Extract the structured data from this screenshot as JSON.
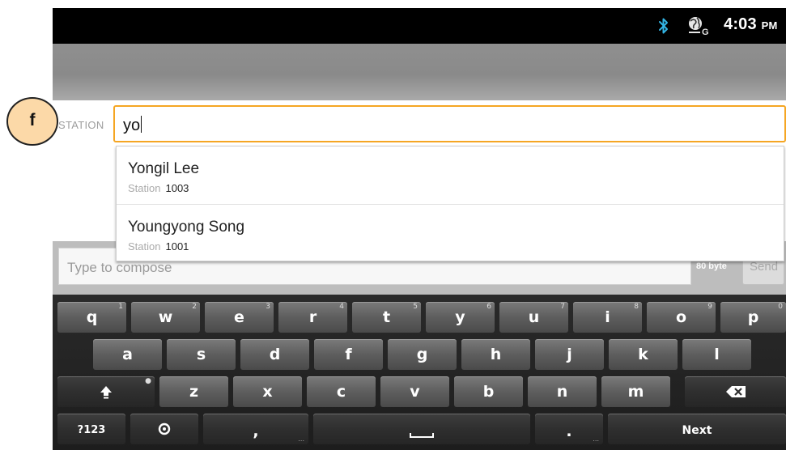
{
  "status_bar": {
    "time": "4:03",
    "ampm": "PM",
    "icons": [
      "bluetooth-icon",
      "network-data-icon"
    ]
  },
  "annotation": {
    "marker": "f"
  },
  "station_field": {
    "label": "STATION",
    "value": "yo"
  },
  "suggestions": [
    {
      "name": "Yongil Lee",
      "sub_label": "Station",
      "number": "1003"
    },
    {
      "name": "Youngyong Song",
      "sub_label": "Station",
      "number": "1001"
    }
  ],
  "compose": {
    "placeholder": "Type to compose",
    "byte_count": "80 byte",
    "send_label": "Send"
  },
  "keyboard": {
    "row1": [
      {
        "label": "q",
        "hint": "1"
      },
      {
        "label": "w",
        "hint": "2"
      },
      {
        "label": "e",
        "hint": "3"
      },
      {
        "label": "r",
        "hint": "4"
      },
      {
        "label": "t",
        "hint": "5"
      },
      {
        "label": "y",
        "hint": "6"
      },
      {
        "label": "u",
        "hint": "7"
      },
      {
        "label": "i",
        "hint": "8"
      },
      {
        "label": "o",
        "hint": "9"
      },
      {
        "label": "p",
        "hint": "0"
      }
    ],
    "row2": [
      {
        "label": "a"
      },
      {
        "label": "s"
      },
      {
        "label": "d"
      },
      {
        "label": "f"
      },
      {
        "label": "g"
      },
      {
        "label": "h"
      },
      {
        "label": "j"
      },
      {
        "label": "k"
      },
      {
        "label": "l"
      }
    ],
    "row3": [
      {
        "label": "z"
      },
      {
        "label": "x"
      },
      {
        "label": "c"
      },
      {
        "label": "v"
      },
      {
        "label": "b"
      },
      {
        "label": "n"
      },
      {
        "label": "m"
      }
    ],
    "symbols_label": "?123",
    "comma_label": ",",
    "period_label": ".",
    "next_label": "Next"
  }
}
